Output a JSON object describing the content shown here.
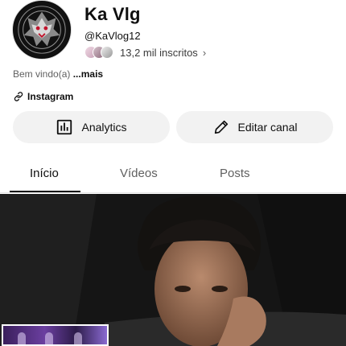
{
  "channel": {
    "name": "Ka Vlg",
    "handle": "@KaVlog12",
    "subscribers": "13,2 mil inscritos",
    "description_prefix": "Bem vindo(a)",
    "description_more": "...mais",
    "link_label": "Instagram"
  },
  "actions": {
    "analytics_label": "Analytics",
    "edit_label": "Editar canal"
  },
  "tabs": [
    {
      "label": "Início",
      "active": true
    },
    {
      "label": "Vídeos",
      "active": false
    },
    {
      "label": "Posts",
      "active": false
    }
  ],
  "icons": {
    "avatar": "wolf-logo-icon",
    "subs_chevron": "chevron-right-icon",
    "link": "link-icon",
    "analytics": "analytics-chart-icon",
    "edit": "pencil-icon"
  },
  "colors": {
    "text_primary": "#0f0f0f",
    "text_secondary": "#606060",
    "button_bg": "#f2f2f2"
  }
}
